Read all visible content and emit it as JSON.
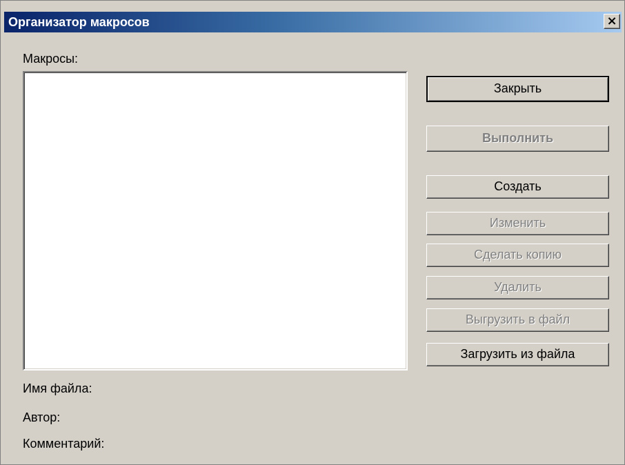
{
  "window": {
    "title": "Организатор макросов",
    "close_symbol": "×"
  },
  "macros_label": "Макросы:",
  "macro_list": [],
  "buttons": {
    "close": "Закрыть",
    "run": "Выполнить",
    "create": "Создать",
    "edit": "Изменить",
    "copy": "Сделать копию",
    "delete": "Удалить",
    "export": "Выгрузить в файл",
    "import": "Загрузить из файла"
  },
  "button_states": {
    "run": "disabled",
    "edit": "disabled",
    "copy": "disabled",
    "delete": "disabled",
    "export": "disabled"
  },
  "info": {
    "filename_label": "Имя файла:",
    "author_label": "Автор:",
    "comment_label": "Комментарий:"
  },
  "colors": {
    "face": "#d4d0c8",
    "titlebar_start": "#0a246a",
    "titlebar_end": "#a6caf0",
    "disabled_text": "#808080"
  }
}
